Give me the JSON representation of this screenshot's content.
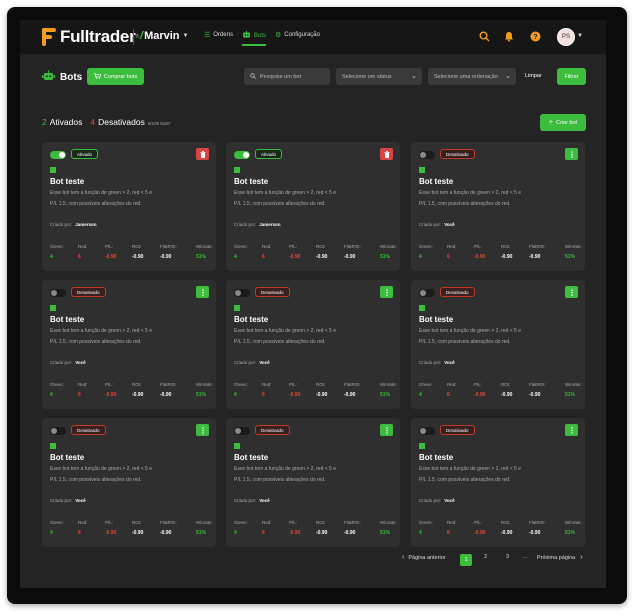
{
  "app": {
    "brand": "Fulltrader",
    "trademark": "®",
    "workspace": "Marvin",
    "nav": [
      {
        "label": "Ordens",
        "icon": "list-icon"
      },
      {
        "label": "Bots",
        "icon": "robot-icon"
      },
      {
        "label": "Configuração",
        "icon": "gear-icon"
      }
    ],
    "avatar_initials": "PS",
    "colors": {
      "accent": "#3dbd3d",
      "danger": "#e0483d",
      "brand": "#f39b1c",
      "background": "#242424",
      "card": "#2f2f2f"
    }
  },
  "header": {
    "title": "Bots",
    "buy_button": "Comprar bots",
    "search_placeholder": "Pesquise um bot",
    "status_select": "Selecione um status",
    "order_select": "Selecione uma ordenação",
    "clear": "Limpar",
    "filter": "Filtrar"
  },
  "summary": {
    "active_count": "2",
    "active_label": "Ativados",
    "inactive_count": "4",
    "inactive_label": "Desativados",
    "capacity": "0/100 bots*",
    "create_button": "Criar bot"
  },
  "stat_labels": [
    "Green:",
    "Red:",
    "P/L:",
    "ROI:",
    "FlatROI:",
    "Winrate:"
  ],
  "cards": [
    {
      "status": "Ativado",
      "active": true,
      "name": "Bot teste",
      "desc": "Esse bot tem a função de green > 2, red < 5 e P/L 1.5, com possíveis alterações do red.",
      "creator_label": "Criado por:",
      "creator": "Jamerson",
      "stats": [
        "4",
        "6",
        "-0.90",
        "-0.90",
        "-0.90",
        "51%"
      ]
    },
    {
      "status": "Ativado",
      "active": true,
      "name": "Bot teste",
      "desc": "Esse bot tem a função de green > 2, red < 5 e P/L 1.5, com possíveis alterações do red.",
      "creator_label": "Criado por:",
      "creator": "Jamerson",
      "stats": [
        "4",
        "6",
        "-0.90",
        "-0.90",
        "-0.90",
        "51%"
      ]
    },
    {
      "status": "Desativado",
      "active": false,
      "name": "Bot teste",
      "desc": "Esse bot tem a função de green > 2, red < 5 e P/L 1.5, com possíveis alterações do red.",
      "creator_label": "Criado por:",
      "creator": "Você",
      "stats": [
        "4",
        "6",
        "-0.90",
        "-0.90",
        "-0.90",
        "51%"
      ]
    },
    {
      "status": "Desativado",
      "active": false,
      "name": "Bot teste",
      "desc": "Esse bot tem a função de green > 2, red < 5 e P/L 1.5, com possíveis alterações do red.",
      "creator_label": "Criado por:",
      "creator": "Você",
      "stats": [
        "4",
        "6",
        "-0.90",
        "-0.90",
        "-0.90",
        "51%"
      ]
    },
    {
      "status": "Desativado",
      "active": false,
      "name": "Bot teste",
      "desc": "Esse bot tem a função de green > 2, red < 5 e P/L 1.5, com possíveis alterações do red.",
      "creator_label": "Criado por:",
      "creator": "Você",
      "stats": [
        "4",
        "6",
        "-0.90",
        "-0.90",
        "-0.90",
        "51%"
      ]
    },
    {
      "status": "Desativado",
      "active": false,
      "name": "Bot teste",
      "desc": "Esse bot tem a função de green > 2, red < 5 e P/L 1.5, com possíveis alterações do red.",
      "creator_label": "Criado por:",
      "creator": "Você",
      "stats": [
        "4",
        "6",
        "-0.90",
        "-0.90",
        "-0.90",
        "51%"
      ]
    },
    {
      "status": "Desativado",
      "active": false,
      "name": "Bot teste",
      "desc": "Esse bot tem a função de green > 2, red < 5 e P/L 1.5, com possíveis alterações do red.",
      "creator_label": "Criado por:",
      "creator": "Você",
      "stats": [
        "4",
        "6",
        "-0.90",
        "-0.90",
        "-0.90",
        "51%"
      ]
    },
    {
      "status": "Desativado",
      "active": false,
      "name": "Bot teste",
      "desc": "Esse bot tem a função de green > 2, red < 5 e P/L 1.5, com possíveis alterações do red.",
      "creator_label": "Criado por:",
      "creator": "Você",
      "stats": [
        "4",
        "6",
        "-0.90",
        "-0.90",
        "-0.90",
        "51%"
      ]
    },
    {
      "status": "Desativado",
      "active": false,
      "name": "Bot teste",
      "desc": "Esse bot tem a função de green > 2, red < 5 e P/L 1.5, com possíveis alterações do red.",
      "creator_label": "Criado por:",
      "creator": "Você",
      "stats": [
        "4",
        "6",
        "-0.90",
        "-0.90",
        "-0.90",
        "51%"
      ]
    }
  ],
  "pagination": {
    "prev": "Página anterior",
    "pages": [
      "1",
      "2",
      "3"
    ],
    "ellipsis": "...",
    "current": "1",
    "next": "Próxima página"
  }
}
